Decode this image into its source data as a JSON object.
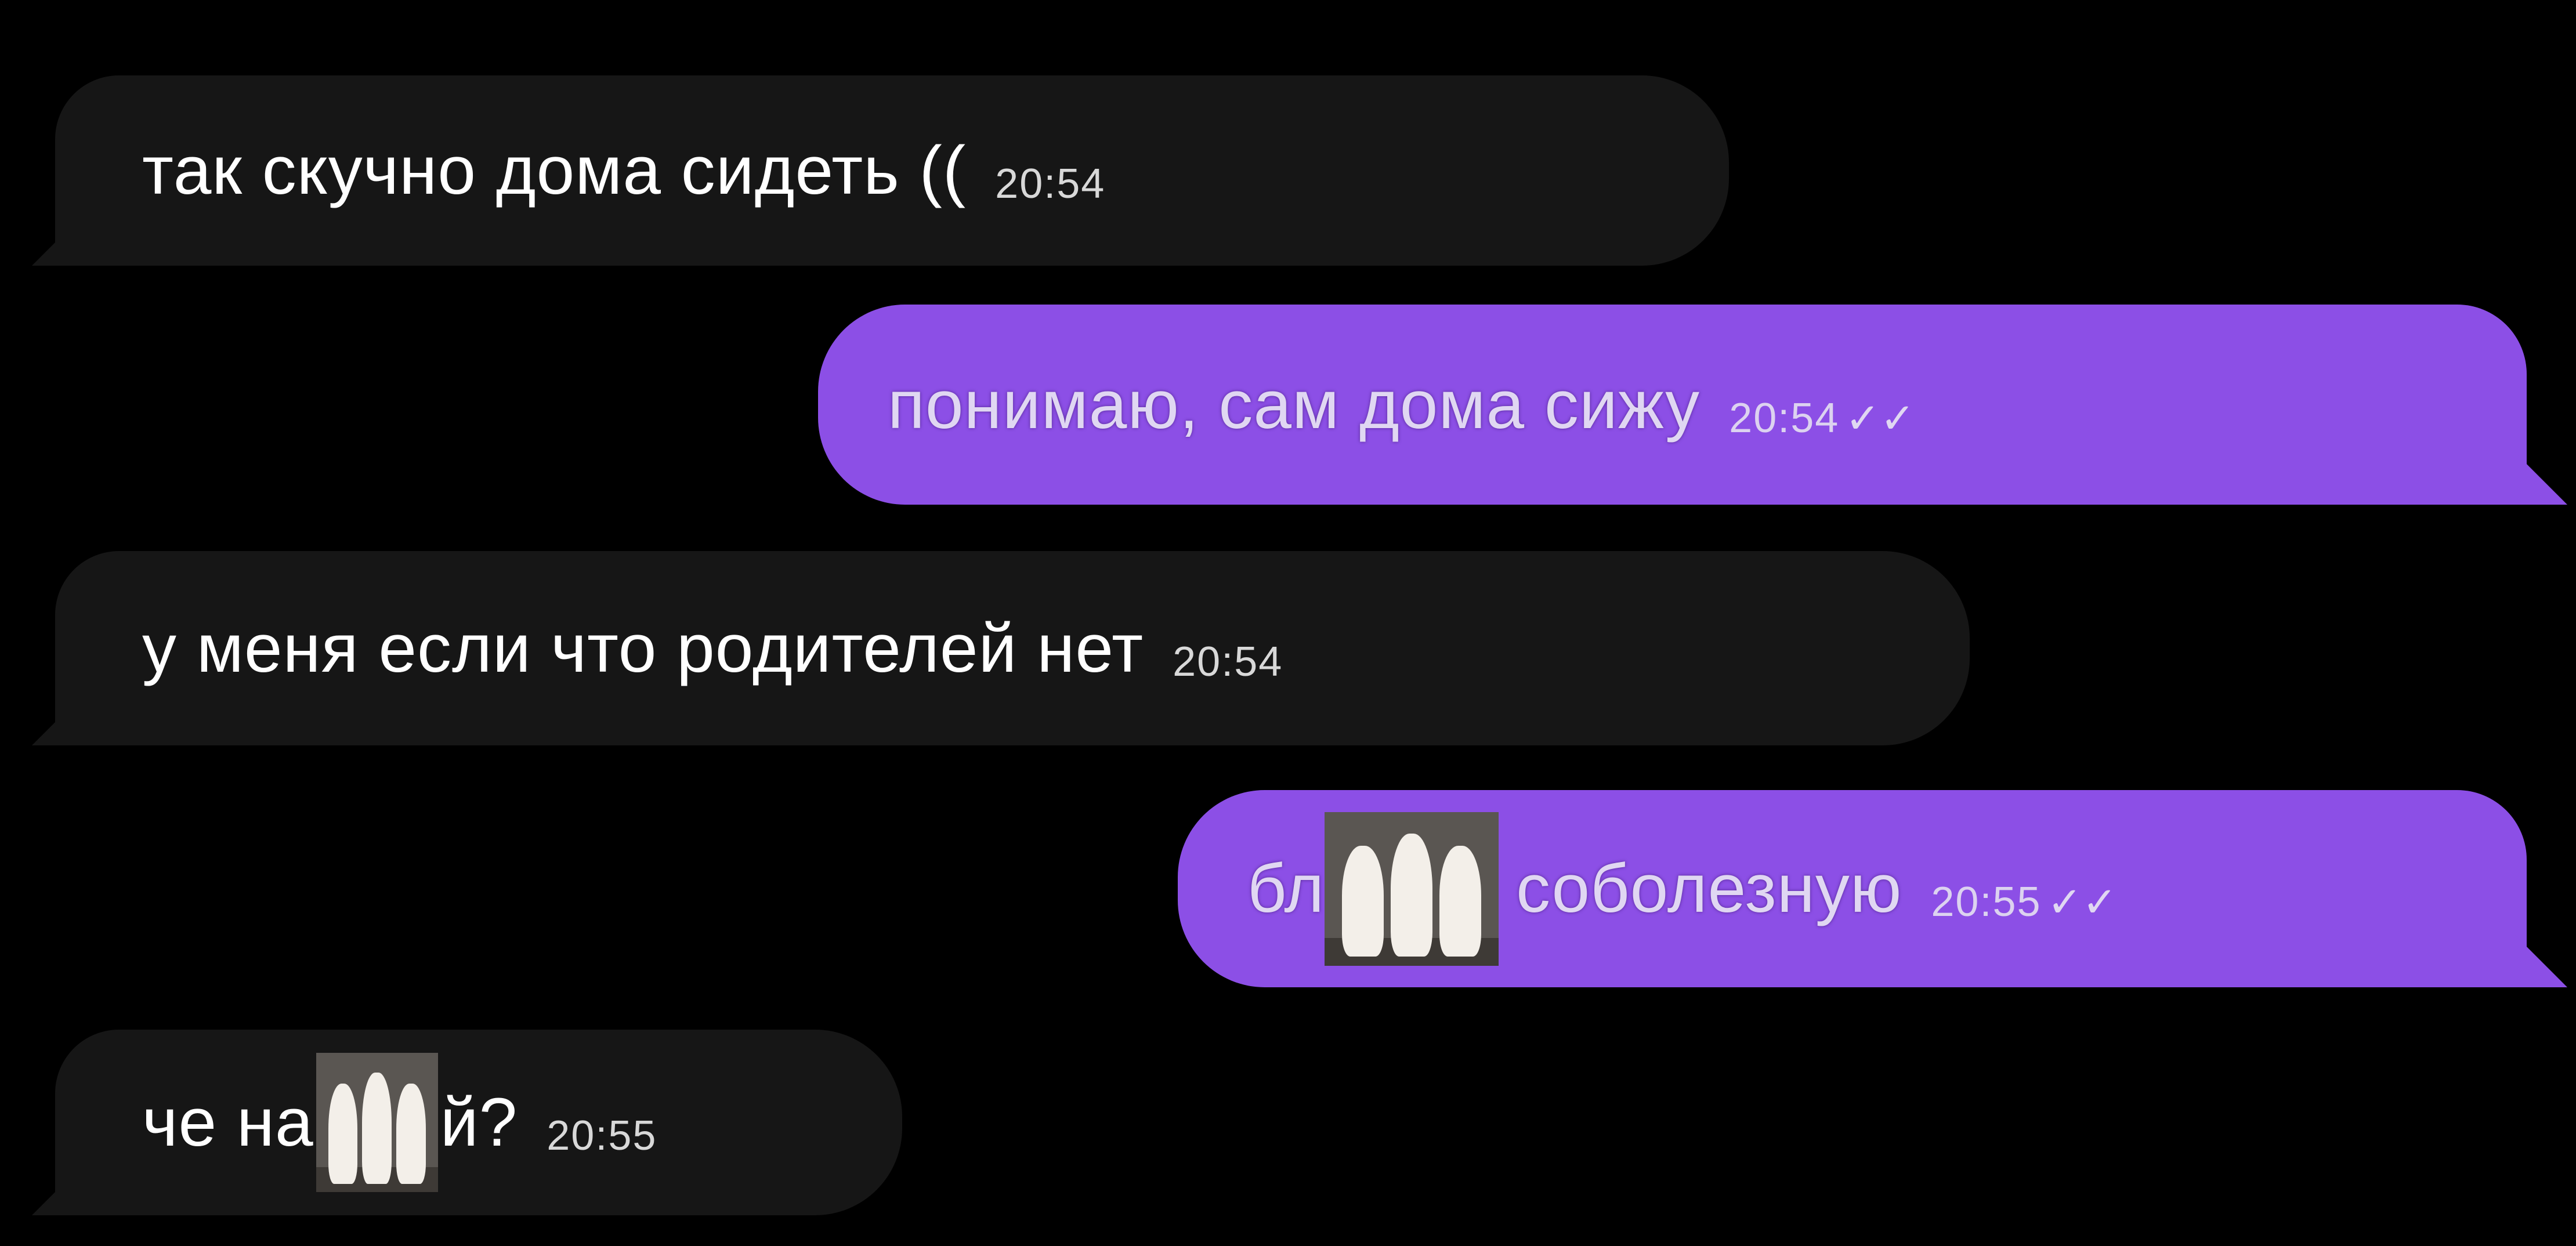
{
  "messages": [
    {
      "text": "так скучно дома сидеть ((",
      "time": "20:54"
    },
    {
      "text": "понимаю, сам дома сижу",
      "time": "20:54",
      "status": "✓✓"
    },
    {
      "text": "у меня если что родителей нет",
      "time": "20:54"
    },
    {
      "text_before": "бл",
      "sticker": "dancing-cats-sticker",
      "text_after": "соболезную",
      "time": "20:55",
      "status": "✓✓"
    },
    {
      "text_before": "че на",
      "sticker": "dancing-cats-sticker",
      "text_after": "й?",
      "time": "20:55"
    }
  ],
  "colors": {
    "background": "#000000",
    "incoming_bubble": "#161616",
    "outgoing_bubble": "#8c4fe6"
  }
}
